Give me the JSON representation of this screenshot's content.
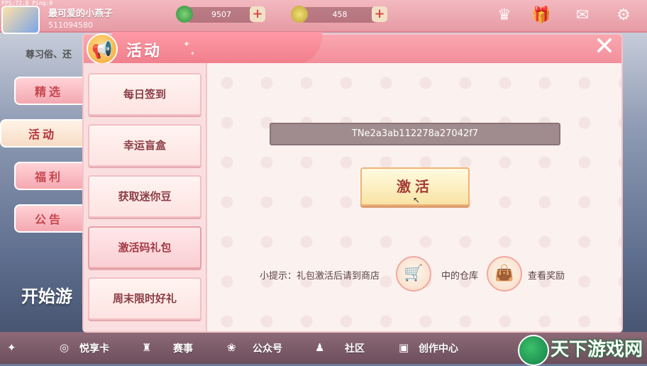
{
  "hud": {
    "fps": "FPS:72.8  Ping:0",
    "player_name": "最可爱的小燕子",
    "player_id": "511094580",
    "currency_green": "9507",
    "currency_gold": "458"
  },
  "background": {
    "ticker": "尊习俗、还",
    "start_game": "开始游",
    "categories": [
      "精选",
      "活动",
      "福利",
      "公告"
    ],
    "bottom_nav": [
      "悦享卡",
      "赛事",
      "公众号",
      "社区",
      "创作中心"
    ],
    "watermark": "天下游戏网"
  },
  "panel": {
    "title": "活动",
    "close_symbol": "✕",
    "menu": [
      "每日签到",
      "幸运盲盒",
      "获取迷你豆",
      "激活码礼包",
      "周末限时好礼"
    ],
    "active_index": 3,
    "code_value": "TNe2a3ab112278a27042f7",
    "activate_label": "激活",
    "tip_part1": "小提示：礼包激活后请到商店",
    "tip_part2": "中的仓库",
    "tip_part3": "查看奖励"
  },
  "colors": {
    "header_pink": "#f28f9b",
    "activate_text": "#a33a34",
    "code_field": "#a08b8e"
  }
}
